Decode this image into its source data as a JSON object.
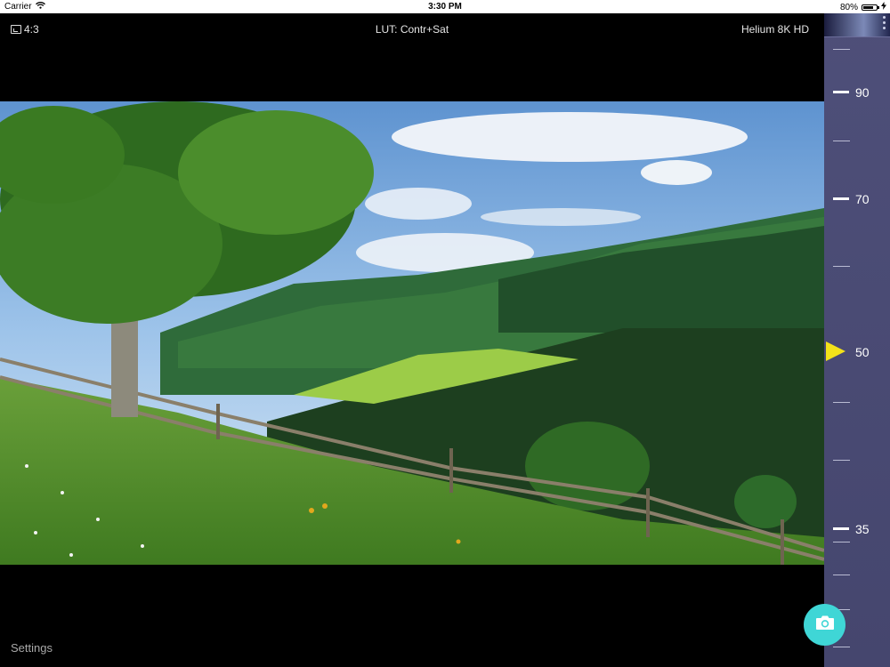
{
  "status_bar": {
    "carrier": "Carrier",
    "time": "3:30 PM",
    "battery_percent": "80%",
    "battery_level": 0.8,
    "icons": [
      "wifi-icon",
      "battery-icon",
      "charging-bolt-icon"
    ]
  },
  "top_bar": {
    "aspect_ratio": "4:3",
    "lut": "LUT: Contr+Sat",
    "lens": "Helium 8K HD"
  },
  "zoom_ruler": {
    "labels": {
      "t90": "90",
      "t70": "70",
      "t50": "50",
      "t35": "35"
    },
    "selected_value": "50",
    "pointer_color": "#f3e21a",
    "background_color": "#4b4c74"
  },
  "bottom": {
    "settings_label": "Settings",
    "shutter_color": "#3fd6d6",
    "shutter_icon": "camera-icon"
  }
}
